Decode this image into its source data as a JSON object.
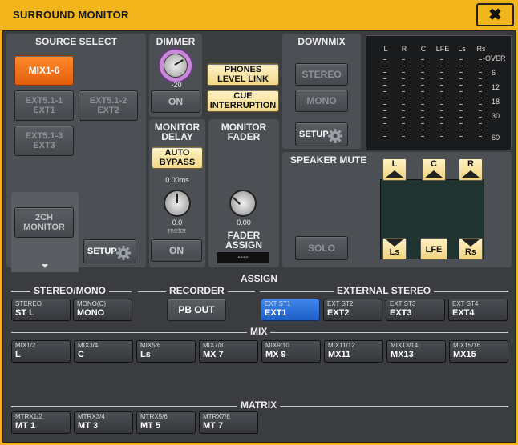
{
  "window": {
    "title": "SURROUND MONITOR",
    "close": "✖"
  },
  "source_select": {
    "header": "SOURCE SELECT",
    "mix": "MIX1-6",
    "ext1a": "EXT5.1-1",
    "ext1b": "EXT1",
    "ext2a": "EXT5.1-2",
    "ext2b": "EXT2",
    "ext3a": "EXT5.1-3",
    "ext3b": "EXT3",
    "mon2a": "2CH",
    "mon2b": "MONITOR",
    "setup": "SETUP"
  },
  "dimmer": {
    "header": "DIMMER",
    "value": "-20",
    "on": "ON"
  },
  "phones": {
    "a": "PHONES",
    "b": "LEVEL LINK"
  },
  "cue": {
    "a": "CUE",
    "b": "INTERRUPTION"
  },
  "monitor_delay": {
    "h1": "MONITOR",
    "h2": "DELAY",
    "auto_a": "AUTO",
    "auto_b": "BYPASS",
    "ms": "0.00ms",
    "val": "0.0",
    "unit": "meter",
    "on": "ON"
  },
  "monitor_fader": {
    "h1": "MONITOR",
    "h2": "FADER",
    "val": "0.00",
    "assign_a": "FADER",
    "assign_b": "ASSIGN",
    "assign_val": "----"
  },
  "downmix": {
    "header": "DOWNMIX",
    "stereo": "STEREO",
    "mono": "MONO",
    "setup": "SETUP"
  },
  "meter": {
    "channels": [
      "L",
      "R",
      "C",
      "LFE",
      "Ls",
      "Rs"
    ],
    "scale": [
      "-OVER",
      "6",
      "12",
      "18",
      "30",
      "60"
    ]
  },
  "speaker_mute": {
    "header": "SPEAKER MUTE",
    "solo": "SOLO",
    "l": "L",
    "c": "C",
    "r": "R",
    "ls": "Ls",
    "lfe": "LFE",
    "rs": "Rs"
  },
  "assign": {
    "header": "ASSIGN",
    "stereo_mono": "STEREO/MONO",
    "recorder": "RECORDER",
    "external_stereo": "EXTERNAL STEREO",
    "mix": "MIX",
    "matrix": "MATRIX",
    "sm": [
      {
        "s": "STEREO",
        "m": "ST L"
      },
      {
        "s": "MONO(C)",
        "m": "MONO"
      }
    ],
    "pbout": "PB OUT",
    "ext": [
      {
        "s": "EXT ST1",
        "m": "EXT1"
      },
      {
        "s": "EXT ST2",
        "m": "EXT2"
      },
      {
        "s": "EXT ST3",
        "m": "EXT3"
      },
      {
        "s": "EXT ST4",
        "m": "EXT4"
      }
    ],
    "mixes": [
      {
        "s": "MIX1/2",
        "m": "L"
      },
      {
        "s": "MIX3/4",
        "m": "C"
      },
      {
        "s": "MIX5/6",
        "m": "Ls"
      },
      {
        "s": "MIX7/8",
        "m": "MX 7"
      },
      {
        "s": "MIX9/10",
        "m": "MX 9"
      },
      {
        "s": "MIX11/12",
        "m": "MX11"
      },
      {
        "s": "MIX13/14",
        "m": "MX13"
      },
      {
        "s": "MIX15/16",
        "m": "MX15"
      }
    ],
    "matrices": [
      {
        "s": "MTRX1/2",
        "m": "MT 1"
      },
      {
        "s": "MTRX3/4",
        "m": "MT 3"
      },
      {
        "s": "MTRX5/6",
        "m": "MT 5"
      },
      {
        "s": "MTRX7/8",
        "m": "MT 7"
      }
    ]
  }
}
